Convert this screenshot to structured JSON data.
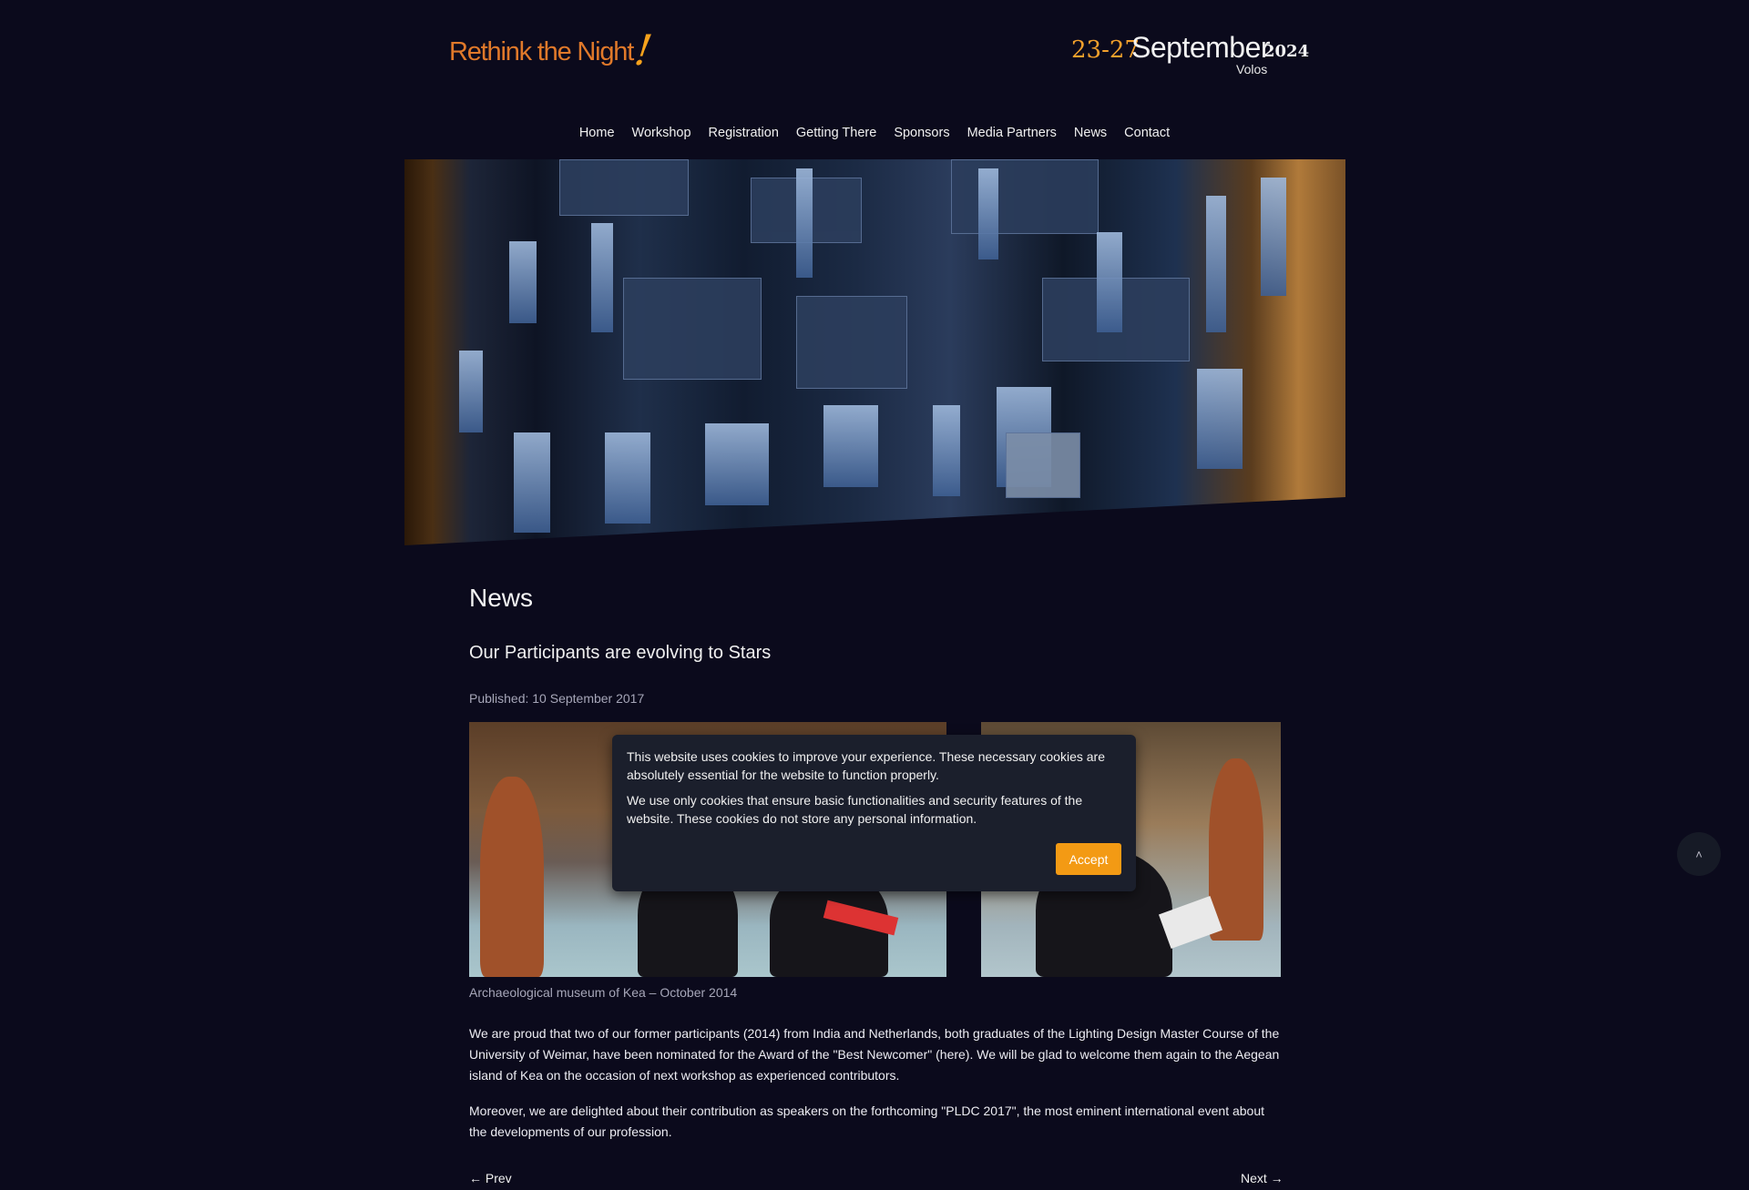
{
  "header": {
    "logo_text": "Rethink the Night",
    "logo_mark": "!",
    "event_days": "23-27",
    "event_month": "September",
    "event_year": "2024",
    "event_city": "Volos"
  },
  "nav": {
    "items": [
      "Home",
      "Workshop",
      "Registration",
      "Getting There",
      "Sponsors",
      "Media Partners",
      "News",
      "Contact"
    ]
  },
  "page": {
    "title": "News",
    "article_title": "Our Participants are evolving to Stars",
    "published": "Published: 10 September 2017",
    "caption": "Archaeological museum of Kea – October 2014",
    "paragraph_1": "We are proud that two of our former participants (2014) from India and Netherlands, both graduates of the Lighting Design Master Course of the University of Weimar, have been nominated for the Award of the \"Best Newcomer\" (here). We will be glad to welcome them again to the Aegean island of Kea on the occasion of next workshop as experienced contributors.",
    "paragraph_2": "Moreover, we are delighted about their contribution as speakers on the forthcoming \"PLDC 2017\", the most eminent international event about the developments of our profession.",
    "prev_label": "← Prev",
    "next_label": "Next →"
  },
  "cookie_banner": {
    "text_1": "This website uses cookies to improve your experience. These necessary cookies are absolutely essential for the website to function properly.",
    "text_2": "We use only cookies that ensure basic functionalities and security features of the website. These cookies do not store any personal information.",
    "accept_label": "Accept"
  },
  "back_to_top": {
    "icon": "chevron-up-icon",
    "glyph": "˄"
  },
  "colors": {
    "background": "#0b0a1c",
    "accent_orange": "#f39a14",
    "logo_orange": "#e0792a",
    "banner_bg": "#1b1f2c"
  }
}
